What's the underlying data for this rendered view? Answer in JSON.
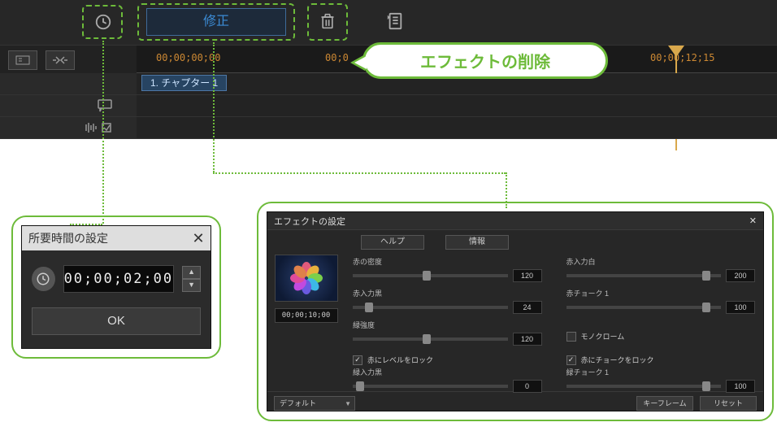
{
  "toolbar": {
    "correct_label": "修正"
  },
  "callout": {
    "text": "エフェクトの削除"
  },
  "ruler": {
    "tc1": "00;00;00;00",
    "tc2": "00;0",
    "tc3": "00;00;12;15"
  },
  "chapter": {
    "label": "1. チャプター 1"
  },
  "dlg_duration": {
    "title": "所要時間の設定",
    "value": "00;00;02;00",
    "ok": "OK"
  },
  "dlg_effect": {
    "title": "エフェクトの設定",
    "tabs": {
      "help": "ヘルプ",
      "info": "情報"
    },
    "preview_tc": "00;00;10;00",
    "params": {
      "p1": {
        "label": "赤の密度",
        "value": "120"
      },
      "p2": {
        "label": "赤入力白",
        "value": "200"
      },
      "p3": {
        "label": "赤入力黒",
        "value": "24"
      },
      "p4": {
        "label": "赤チョーク 1",
        "value": "100"
      },
      "p5": {
        "label": "緑強度",
        "value": "120"
      },
      "p6": {
        "label": "モノクローム"
      },
      "c1": {
        "label": "赤にレベルをロック"
      },
      "c2": {
        "label": "赤にチョークをロック"
      },
      "p7": {
        "label": "緑入力黒",
        "value": "0"
      },
      "p8": {
        "label": "緑チョーク 1",
        "value": "100"
      }
    },
    "preset": "デフォルト",
    "keyframe": "キーフレーム",
    "reset": "リセット"
  }
}
